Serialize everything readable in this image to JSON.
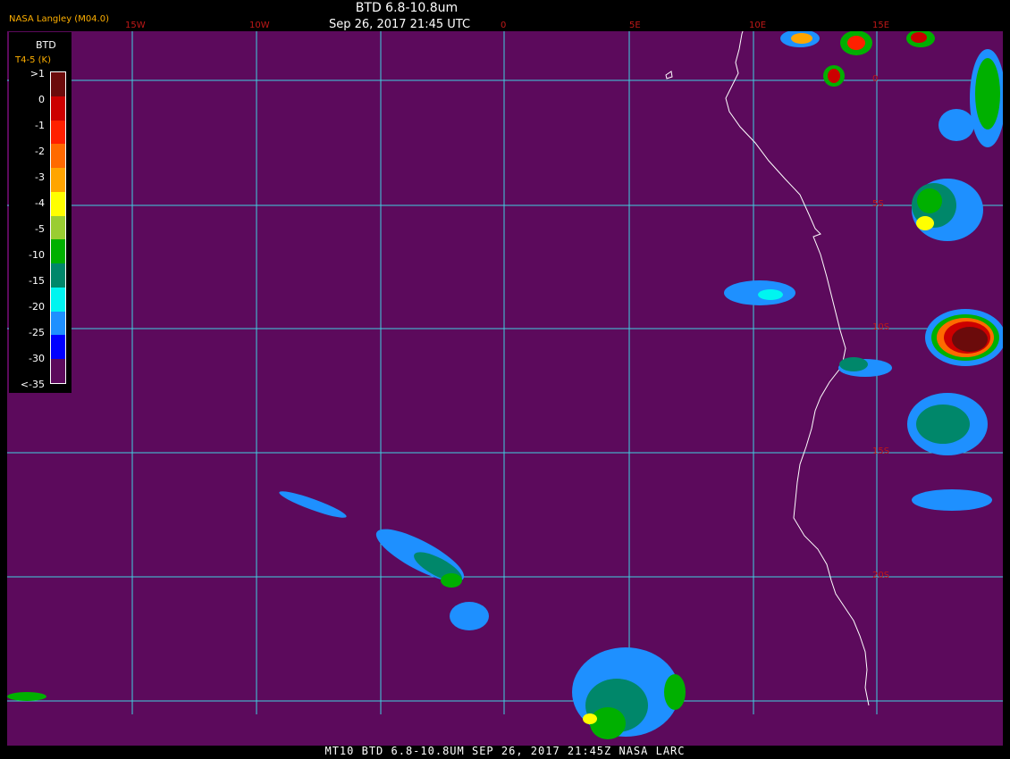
{
  "header": {
    "credit": "NASA Langley (M04.0)",
    "title": "BTD 6.8-10.8um",
    "datetime": "Sep 26, 2017 21:45 UTC"
  },
  "footer": "MT10  BTD 6.8-10.8UM  SEP 26, 2017 21:45Z  NASA LARC",
  "legend": {
    "title": "BTD",
    "units": "T4-5 (K)",
    "ticks": [
      ">1",
      "0",
      "-1",
      "-2",
      "-3",
      "-4",
      "-5",
      "-10",
      "-15",
      "-20",
      "-25",
      "-30",
      "<-35"
    ],
    "colors": [
      "#6b0b0b",
      "#cc0000",
      "#ff2000",
      "#ff6a00",
      "#ffa500",
      "#ffff00",
      "#9acd32",
      "#00b000",
      "#00876a",
      "#00f5f0",
      "#1e90ff",
      "#0000ff",
      "#5c0a5c"
    ]
  },
  "map": {
    "background_color": "#5c0a5c",
    "grid_color": "#40d0e0",
    "coastline_color": "#ffffff",
    "label_color": "#c01818",
    "lon_labels": [
      "15W",
      "10W",
      "0",
      "5E",
      "10E",
      "15E"
    ],
    "lat_labels": [
      "0",
      "5S",
      "10S",
      "15S",
      "20S"
    ]
  }
}
